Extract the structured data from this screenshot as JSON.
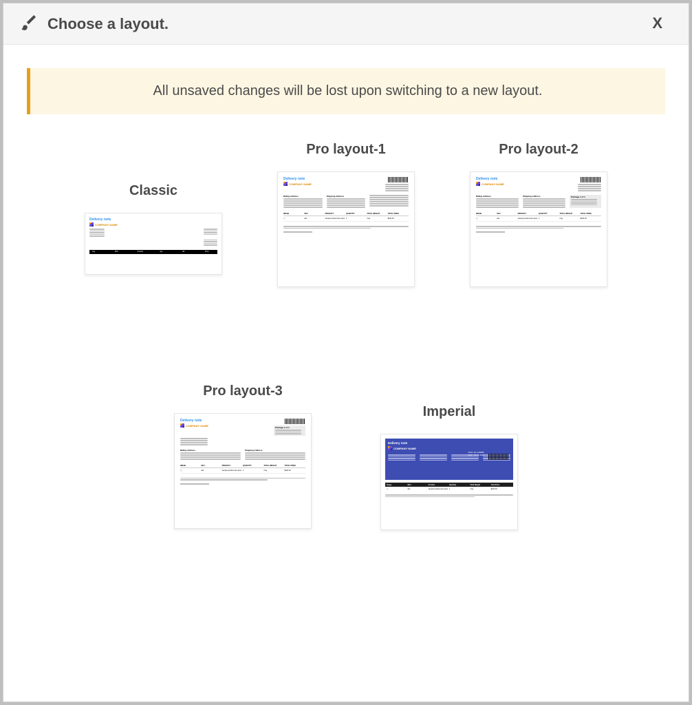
{
  "header": {
    "title": "Choose a layout.",
    "close_label": "X"
  },
  "warning": {
    "message": "All unsaved changes will be lost upon switching to a new layout."
  },
  "layouts": {
    "classic": {
      "title": "Classic"
    },
    "pro1": {
      "title": "Pro layout-1"
    },
    "pro2": {
      "title": "Pro layout-2"
    },
    "pro3": {
      "title": "Pro layout-3"
    },
    "imperial": {
      "title": "Imperial"
    }
  },
  "preview": {
    "delivery_note_label": "Delivery note",
    "company_name": "COMPANY NAME",
    "billing_label": "Billing Address",
    "shipping_label": "Shipping Address",
    "table_cols": {
      "image": "IMAGE",
      "sku": "SKU",
      "product": "PRODUCT",
      "quantity": "QUANTITY",
      "weight": "TOTAL WEIGHT",
      "price": "TOTAL PRICE"
    },
    "package_label": "Package 1 of 1",
    "order_label": "Order No",
    "thanks": "Thank you for purchasing."
  }
}
